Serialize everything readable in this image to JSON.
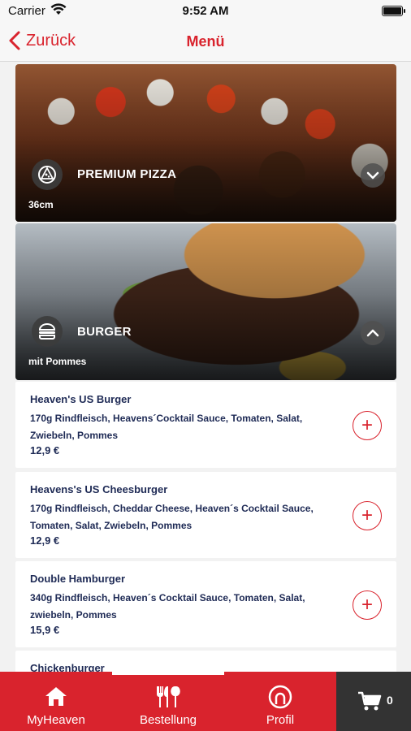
{
  "status_bar": {
    "carrier": "Carrier",
    "time": "9:52 AM"
  },
  "nav": {
    "back_label": "Zurück",
    "title": "Menü"
  },
  "categories": [
    {
      "title": "PREMIUM PIZZA",
      "subtitle": "36cm",
      "icon": "pizza-icon",
      "expanded": false
    },
    {
      "title": "BURGER",
      "subtitle": "mit Pommes",
      "icon": "burger-icon",
      "expanded": true
    }
  ],
  "items": [
    {
      "name": "Heaven's US Burger",
      "desc_lines": [
        "170g Rindfleisch, Heavens´Cocktail Sauce, Tomaten, Salat,",
        "Zwiebeln, Pommes"
      ],
      "price": "12,9 €"
    },
    {
      "name": "Heavens's  US Cheesburger",
      "desc_lines": [
        "170g Rindfleisch, Cheddar Cheese, Heaven´s Cocktail Sauce,",
        "Tomaten, Salat, Zwiebeln, Pommes"
      ],
      "price": "12,9 €"
    },
    {
      "name": "Double Hamburger",
      "desc_lines": [
        "340g Rindfleisch, Heaven´s Cocktail Sauce, Tomaten, Salat,",
        "zwiebeln, Pommes"
      ],
      "price": "15,9 €"
    },
    {
      "name": "Chickenburger"
    }
  ],
  "tabs": [
    {
      "label": "MyHeaven",
      "icon": "home-icon"
    },
    {
      "label": "Bestellung",
      "icon": "cutlery-icon",
      "active": true
    },
    {
      "label": "Profil",
      "icon": "profile-icon"
    }
  ],
  "cart": {
    "count": "0",
    "icon": "cart-icon"
  },
  "colors": {
    "accent": "#d9232d",
    "text_dark": "#1e2a55",
    "cart_bg": "#333333"
  }
}
